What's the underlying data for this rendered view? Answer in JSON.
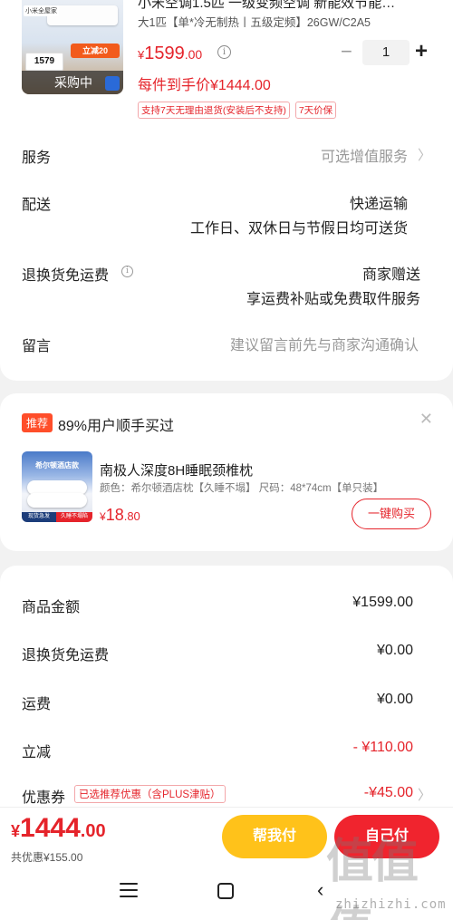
{
  "product": {
    "title": "小米空调1.5匹 一级变频空调 新能效节能…",
    "spec": "大1匹【单*冷无制热丨五级定频】26GW/C2A5",
    "thumb_overlay": "采购中",
    "thumb_tag": "小米全屋家",
    "thumb_promo": "立减20",
    "thumb_price": "1579",
    "price_currency": "¥",
    "price_int": "1599",
    "price_dec": ".00",
    "qty": "1",
    "final_price": "每件到手价¥1444.00",
    "tags": [
      "支持7天无理由退货(安装后不支持)",
      "7天价保"
    ]
  },
  "rows": {
    "service_label": "服务",
    "service_value": "可选增值服务",
    "delivery_label": "配送",
    "delivery_value1": "快递运输",
    "delivery_value2": "工作日、双休日与节假日均可送货",
    "return_label": "退换货免运费",
    "return_value1": "商家赠送",
    "return_value2": "享运费补贴或免费取件服务",
    "note_label": "留言",
    "note_placeholder": "建议留言前先与商家沟通确认"
  },
  "recommend": {
    "tag": "推荐",
    "headline": "89%用户顺手买过",
    "img_header": "希尔顿酒店款",
    "img_badge1": "现货急发",
    "img_badge2": "久睡不塌陷",
    "name": "南极人深度8H睡眠颈椎枕",
    "attrs": "颜色：希尔顿酒店枕【久睡不塌】  尺码：48*74cm【单只装】",
    "price_currency": "¥",
    "price_int": "18",
    "price_dec": ".80",
    "buy_label": "一键购买"
  },
  "summary": {
    "items": [
      {
        "label": "商品金额",
        "value": "¥1599.00"
      },
      {
        "label": "退换货免运费",
        "value": "¥0.00"
      },
      {
        "label": "运费",
        "value": "¥0.00"
      },
      {
        "label": "立减",
        "value": "- ¥110.00"
      },
      {
        "label": "优惠券",
        "value": "-¥45.00",
        "tag": "已选推荐优惠（含PLUS津贴）"
      }
    ]
  },
  "bottom": {
    "total_currency": "¥",
    "total_int": "1444",
    "total_dec": ".00",
    "saved": "共优惠¥155.00",
    "help_label": "帮我付",
    "self_label": "自己付"
  },
  "watermark": {
    "big": "值值值",
    "small": "zhizhizhi.com"
  },
  "colors": {
    "accent_red": "#e5242b",
    "pay_red": "#f0242e",
    "help_yellow": "#ffc21a",
    "rec_tag": "#ff4e2a"
  }
}
